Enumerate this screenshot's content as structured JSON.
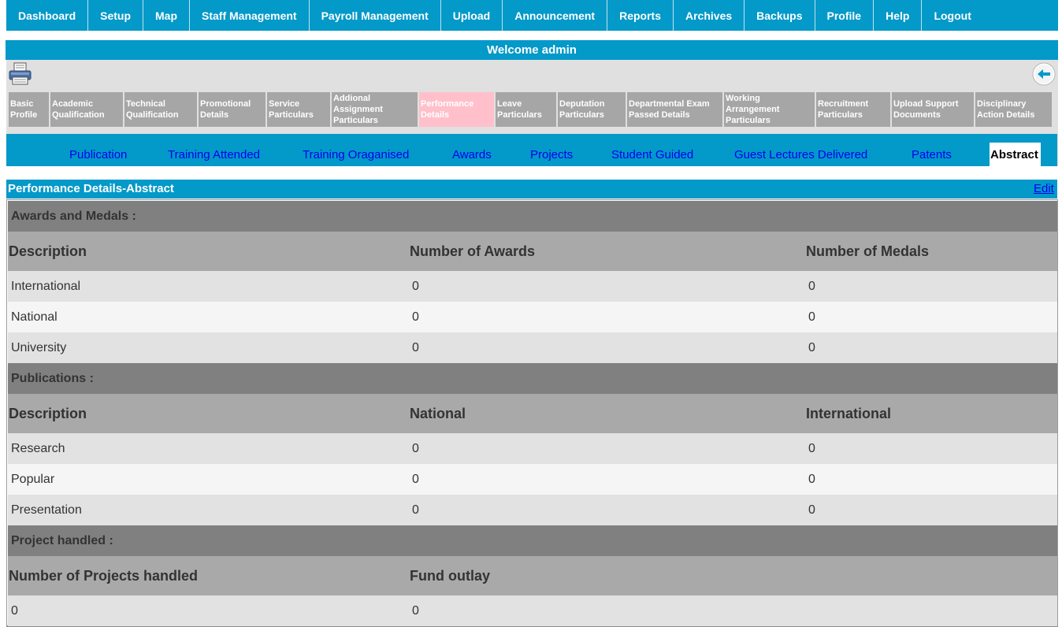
{
  "nav": {
    "items": [
      "Dashboard",
      "Setup",
      "Map",
      "Staff Management",
      "Payroll Management",
      "Upload",
      "Announcement",
      "Reports",
      "Archives",
      "Backups",
      "Profile",
      "Help",
      "Logout"
    ]
  },
  "welcome": "Welcome admin",
  "subtabs": [
    {
      "label": "Basic Profile",
      "active": false
    },
    {
      "label": "Academic Qualification",
      "active": false
    },
    {
      "label": "Technical Qualification",
      "active": false
    },
    {
      "label": "Promotional Details",
      "active": false
    },
    {
      "label": "Service Particulars",
      "active": false
    },
    {
      "label": "Addional Assignment Particulars",
      "active": false
    },
    {
      "label": "Performance Details",
      "active": true
    },
    {
      "label": "Leave Particulars",
      "active": false
    },
    {
      "label": "Deputation Particulars",
      "active": false
    },
    {
      "label": "Departmental Exam Passed Details",
      "active": false
    },
    {
      "label": "Working Arrangement Particulars",
      "active": false
    },
    {
      "label": "Recruitment Particulars",
      "active": false
    },
    {
      "label": "Upload Support Documents",
      "active": false
    },
    {
      "label": "Disciplinary Action Details",
      "active": false
    }
  ],
  "perf_tabs": [
    "Publication",
    "Training Attended",
    "Training Oraganised",
    "Awards",
    "Projects",
    "Student Guided",
    "Guest Lectures Delivered",
    "Patents",
    "Abstract"
  ],
  "perf_active": "Abstract",
  "section": {
    "title": "Performance Details-Abstract",
    "edit": "Edit"
  },
  "awards": {
    "title": "Awards and Medals :",
    "headers": [
      "Description",
      "Number of Awards",
      "Number of Medals"
    ],
    "rows": [
      [
        "International",
        "0",
        "0"
      ],
      [
        "National",
        "0",
        "0"
      ],
      [
        "University",
        "0",
        "0"
      ]
    ]
  },
  "publications": {
    "title": "Publications :",
    "headers": [
      "Description",
      "National",
      "International"
    ],
    "rows": [
      [
        "Research",
        "0",
        "0"
      ],
      [
        "Popular",
        "0",
        "0"
      ],
      [
        "Presentation",
        "0",
        "0"
      ]
    ]
  },
  "projects": {
    "title": "Project handled :",
    "headers": [
      "Number of Projects handled",
      "Fund outlay"
    ],
    "rows": [
      [
        "0",
        "0"
      ]
    ]
  },
  "colors": {
    "primary": "#0399c9",
    "active_tab": "#ffc0cb",
    "tab_gray": "#a6a6a6",
    "group_row": "#808080"
  },
  "icons": {
    "print": "printer-icon",
    "back": "back-arrow-icon"
  }
}
